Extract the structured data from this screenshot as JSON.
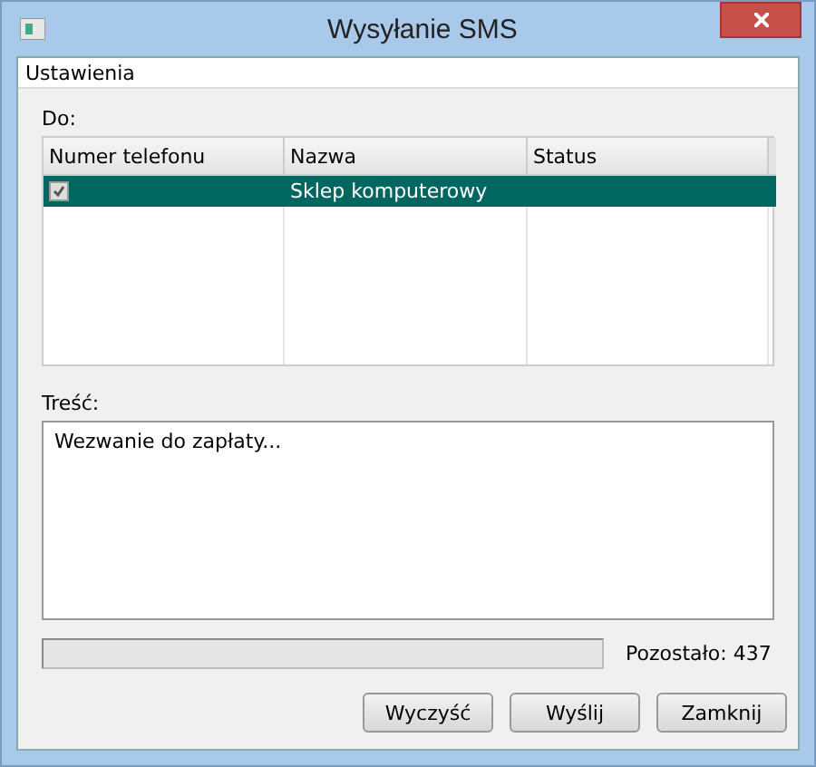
{
  "window": {
    "title": "Wysyłanie SMS"
  },
  "menu": [
    "Ustawienia"
  ],
  "recipients": {
    "label": "Do:",
    "columns": [
      "Numer telefonu",
      "Nazwa",
      "Status"
    ],
    "rows": [
      {
        "checked": true,
        "selected": true,
        "cells": [
          "",
          "Sklep komputerowy",
          ""
        ]
      }
    ]
  },
  "message": {
    "label": "Treść:",
    "value": "Wezwanie do zapłaty..."
  },
  "remaining": "Pozostało: 437",
  "buttons": [
    "Wyczyść",
    "Wyślij",
    "Zamknij"
  ]
}
